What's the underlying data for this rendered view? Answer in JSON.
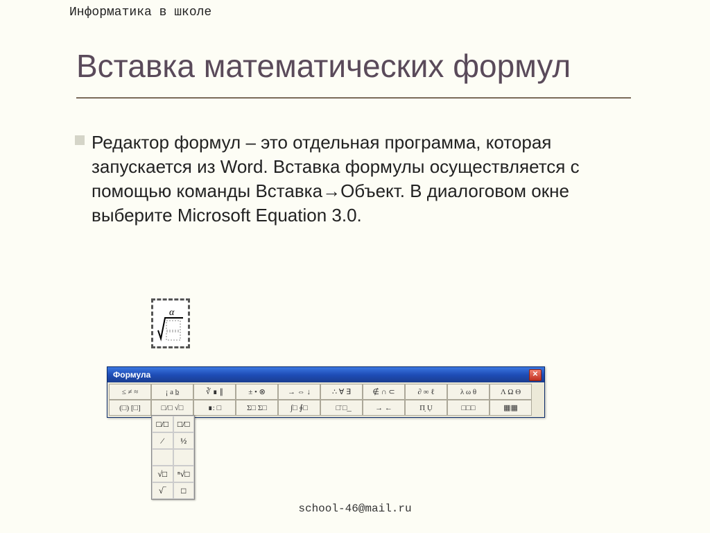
{
  "header": "Информатика в школе",
  "title": "Вставка математических формул",
  "body": "Редактор формул – это отдельная программа, которая запускается из Word. Вставка формулы осуществляется с помощью команды Вставка→Объект. В диалоговом окне выберите Microsoft Equation 3.0.",
  "formula_window": {
    "title": "Формула",
    "row1": [
      "≤ ≠ ≈",
      "¡ a b̲",
      "∛ ∎ ∥",
      "± • ⊗",
      "→ ⇔ ↓",
      "∴ ∀ ∃",
      "∉ ∩ ⊂",
      "∂ ∞ ℓ",
      "λ ω θ",
      "Λ Ω Θ"
    ],
    "row2": [
      "(□) [□]",
      "□/□ √□",
      "∎: □",
      "Σ□ Σ□",
      "∫□ ∮□",
      "□̄ □͟",
      "→ ←",
      "Π̣ Ụ",
      "□□□",
      "▦▦"
    ],
    "dropdown": [
      [
        "□/□",
        "□/□"
      ],
      [
        "⁄",
        "½"
      ],
      [
        "",
        ""
      ],
      [
        "√□",
        "ⁿ√□"
      ],
      [
        "√‾",
        "□"
      ]
    ]
  },
  "footer": "school-46@mail.ru"
}
